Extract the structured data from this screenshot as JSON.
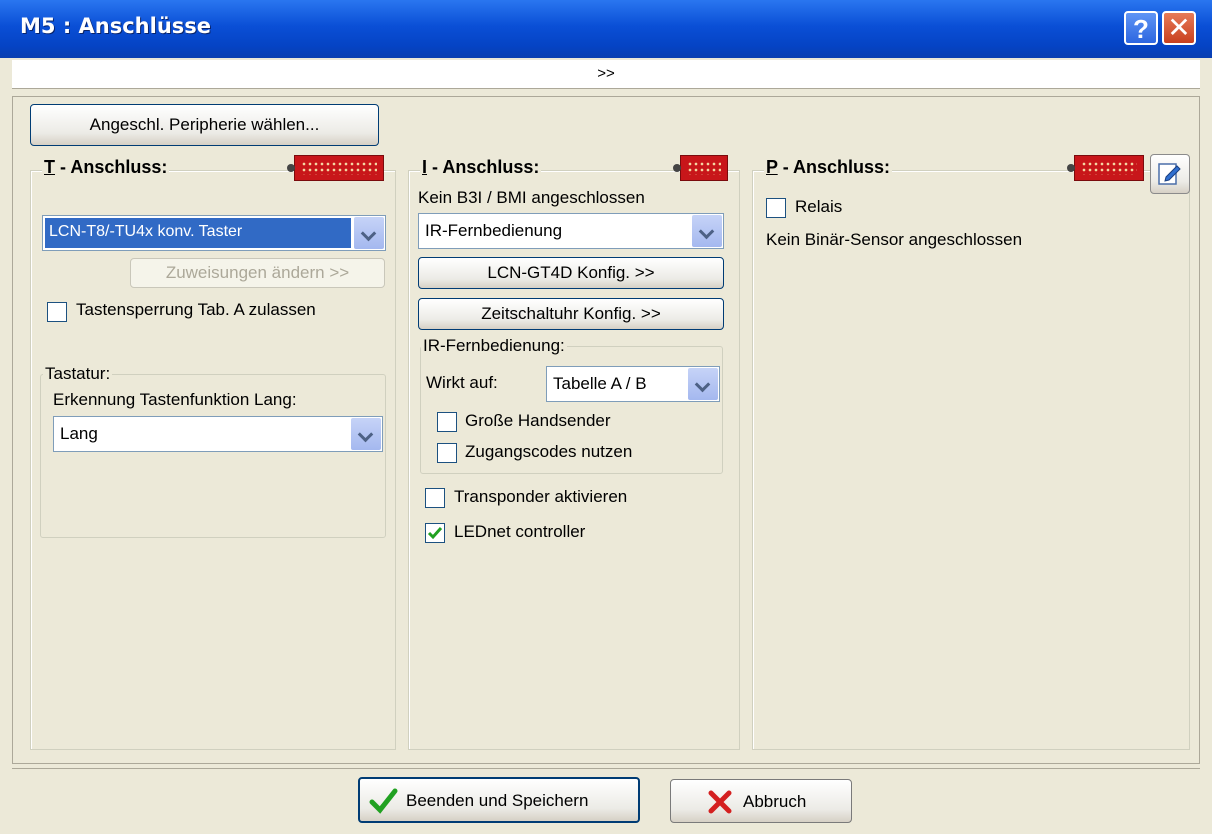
{
  "window": {
    "title": "M5 : Anschlüsse",
    "help_label": "?",
    "close_label": "✕"
  },
  "expander": {
    "label": ">>"
  },
  "peripherie_button": "Angeschl. Peripherie wählen...",
  "t_group": {
    "title": "T - Anschluss:",
    "mnemonic": "T",
    "title_rest": " - Anschluss:",
    "combo_value": "LCN-T8/-TU4x konv. Taster",
    "assign_button": "Zuweisungen ändern >>",
    "lock_label": "Tastensperrung Tab. A zulassen",
    "keyboard_frame": {
      "title": "Tastatur:",
      "detect_label": "Erkennung Tastenfunktion Lang:",
      "detect_value": "Lang"
    }
  },
  "i_group": {
    "mnemonic": "I",
    "title_rest": " - Anschluss:",
    "status": "Kein B3I / BMI angeschlossen",
    "combo_value": "IR-Fernbedienung",
    "gt4d_button": "LCN-GT4D Konfig. >>",
    "timer_button": "Zeitschaltuhr Konfig. >>",
    "ir_frame": {
      "title": "IR-Fernbedienung:",
      "wirkt_label": "Wirkt auf:",
      "wirkt_value": "Tabelle A / B",
      "large_sender_label": "Große Handsender",
      "access_codes_label": "Zugangscodes nutzen"
    },
    "transponder_label": "Transponder aktivieren",
    "lednet_label": "LEDnet controller",
    "lednet_checked": true
  },
  "p_group": {
    "mnemonic": "P",
    "title_rest": " - Anschluss:",
    "relais_label": "Relais",
    "status": "Kein Binär-Sensor angeschlossen"
  },
  "footer": {
    "save_label": "Beenden und Speichern",
    "cancel_label": "Abbruch"
  },
  "colors": {
    "titlebar": "#0A4FD6",
    "dialog_bg": "#ECE9D8",
    "plug_red": "#C8161A",
    "check_green": "#21A121",
    "cancel_red": "#D42020",
    "combo_selected": "#316AC5"
  }
}
